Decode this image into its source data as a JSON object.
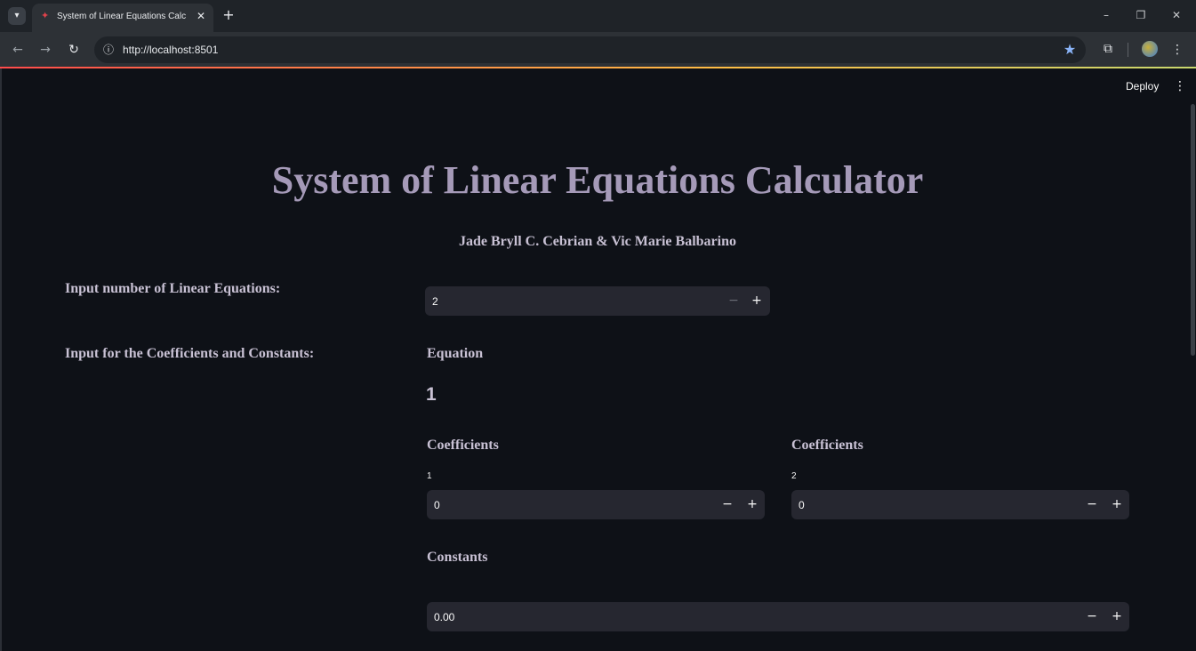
{
  "browser": {
    "tab_title": "System of Linear Equations Calc",
    "url": "http://localhost:8501",
    "icons": {
      "tab_list": "chevron-down-icon",
      "favicon": "streamlit-icon",
      "tab_close": "close-icon",
      "new_tab": "plus-icon",
      "back": "arrow-left-icon",
      "forward": "arrow-right-icon",
      "reload": "reload-icon",
      "site_info": "info-icon",
      "bookmark": "star-icon",
      "extensions": "puzzle-icon",
      "menu": "kebab-menu-icon"
    }
  },
  "app": {
    "deploy_label": "Deploy",
    "title": "System of Linear Equations Calculator",
    "authors": "Jade Bryll C. Cebrian & Vic Marie Balbarino",
    "num_equations": {
      "label": "Input number of Linear Equations:",
      "value": "2"
    },
    "coeff_section_label": "Input for the Coefficients and Constants:",
    "equation": {
      "heading": "Equation",
      "number": "1",
      "coefficients": [
        {
          "heading": "Coefficients",
          "index_label": "1",
          "value": "0"
        },
        {
          "heading": "Coefficients",
          "index_label": "2",
          "value": "0"
        }
      ],
      "constants": {
        "heading": "Constants",
        "value": "0.00"
      }
    }
  },
  "colors": {
    "background": "#0e1117",
    "input_bg": "#262730",
    "title": "#a59ab8",
    "label": "#c8c1d4"
  }
}
